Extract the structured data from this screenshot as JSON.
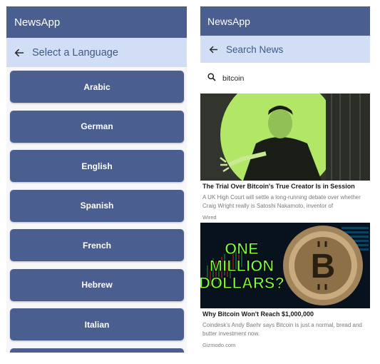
{
  "left_screen": {
    "app_title": "NewsApp",
    "subheader": "Select a Language",
    "languages": [
      "Arabic",
      "German",
      "English",
      "Spanish",
      "French",
      "Hebrew",
      "Italian"
    ]
  },
  "right_screen": {
    "app_title": "NewsApp",
    "subheader": "Search News",
    "search_query": "bitcoin",
    "articles": [
      {
        "title": "The Trial Over Bitcoin's True Creator Is in Session",
        "description": "A UK High Court will settle a long-running debate over whether Craig Wright really is Satoshi Nakamoto, inventor of",
        "source": "Wired"
      },
      {
        "title": "Why Bitcoin Won't Reach $1,000,000",
        "description": "Coindesk's Andy Baehr says Bitcoin is just a normal, bread and butter investment now.",
        "source": "Gizmodo.com",
        "image_text": [
          "ONE",
          "MILLION",
          "DOLLARS?"
        ]
      }
    ]
  },
  "colors": {
    "appbar": "#4a5f8f",
    "subbar": "#d2def5",
    "button": "#4a5f8f",
    "image1_tint": "#b8f06a",
    "image2_text": "#7dff3a"
  },
  "icons": [
    "back-arrow-icon",
    "search-icon"
  ]
}
